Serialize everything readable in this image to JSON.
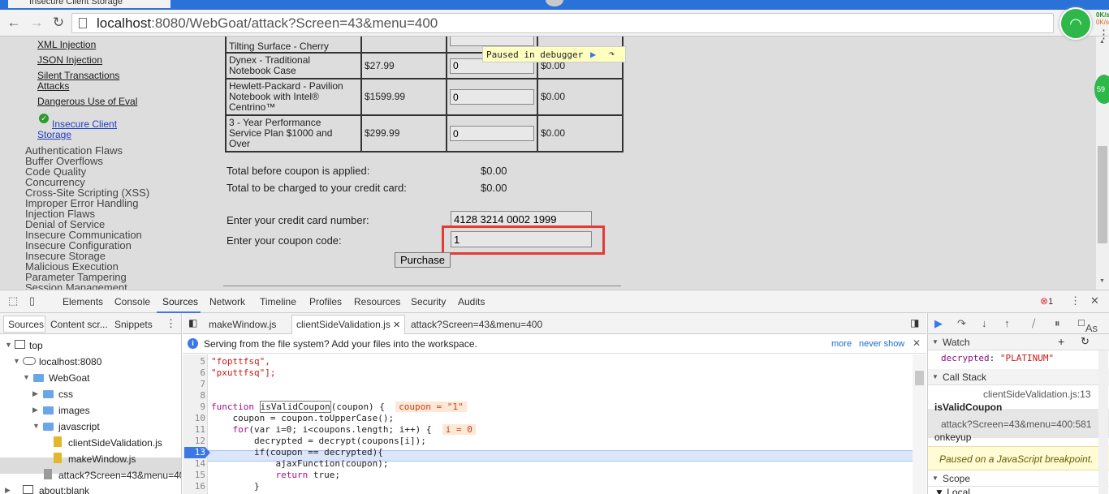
{
  "browser": {
    "tab_title": "Insecure Client Storage",
    "url_host": "localhost",
    "url_rest": ":8080/WebGoat/attack?Screen=43&menu=400",
    "extension_text": "59",
    "wifi_side_top": "0K/s",
    "wifi_side_bottom": "0K/s"
  },
  "sidebar": {
    "sub_links": [
      "XML Injection",
      "JSON Injection",
      "Silent Transactions",
      "Attacks",
      "Dangerous Use of Eval"
    ],
    "current_link_line1": "Insecure Client",
    "current_link_line2": "Storage",
    "categories": [
      "Authentication Flaws",
      "Buffer Overflows",
      "Code Quality",
      "Concurrency",
      "Cross-Site Scripting (XSS)",
      "Improper Error Handling",
      "Injection Flaws",
      "Denial of Service",
      "Insecure Communication",
      "Insecure Configuration",
      "Insecure Storage",
      "Malicious Execution",
      "Parameter Tampering",
      "Session Management"
    ]
  },
  "products": [
    {
      "line1": "Tilting Surface - Cherry",
      "line2": "",
      "line3": "",
      "price": "",
      "qty": "",
      "total": ""
    },
    {
      "line1": "Dynex - Traditional",
      "line2": "Notebook Case",
      "line3": "",
      "price": "$27.99",
      "qty": "0",
      "total": "$0.00"
    },
    {
      "line1": "Hewlett-Packard - Pavilion",
      "line2": "Notebook with Intel®",
      "line3": "Centrino™",
      "price": "$1599.99",
      "qty": "0",
      "total": "$0.00"
    },
    {
      "line1": "3 - Year Performance",
      "line2": "Service Plan $1000 and",
      "line3": "Over",
      "price": "$299.99",
      "qty": "0",
      "total": "$0.00"
    }
  ],
  "checkout": {
    "before_coupon_label": "Total before coupon is applied:",
    "before_coupon_value": "$0.00",
    "charged_label": "Total to be charged to your credit card:",
    "charged_value": "$0.00",
    "card_label": "Enter your credit card number:",
    "card_value": "4128 3214 0002 1999",
    "coupon_label": "Enter your coupon code:",
    "coupon_value": "1",
    "purchase_label": "Purchase"
  },
  "debugger_overlay": {
    "text": "Paused in debugger"
  },
  "devtools": {
    "tabs": [
      "Elements",
      "Console",
      "Sources",
      "Network",
      "Timeline",
      "Profiles",
      "Resources",
      "Security",
      "Audits"
    ],
    "error_count": "1",
    "navigator_tabs": [
      "Sources",
      "Content scr...",
      "Snippets"
    ],
    "tree": {
      "top": "top",
      "host": "localhost:8080",
      "webgoat": "WebGoat",
      "css": "css",
      "images": "images",
      "javascript": "javascript",
      "file1": "clientSideValidation.js",
      "file2": "makeWindow.js",
      "file3": "attack?Screen=43&menu=40",
      "blank": "about:blank"
    },
    "editor_tabs": [
      "makeWindow.js",
      "clientSideValidation.js",
      "attack?Screen=43&menu=400"
    ],
    "infobar": {
      "message": "Serving from the file system? Add your files into the workspace.",
      "more": "more",
      "never": "never show"
    },
    "line_numbers": [
      "5",
      "6",
      "7",
      "8",
      "9",
      "10",
      "11",
      "12",
      "13",
      "14",
      "15",
      "16"
    ],
    "code": {
      "l5": "\"fopttfsq\",",
      "l6": "\"pxuttfsq\"];",
      "l9_kw": "function",
      "l9_name": "isValidCoupon",
      "l9_rest": "(coupon) {",
      "l9_inline": "coupon = \"1\"",
      "l10": "    coupon = coupon.toUpperCase();",
      "l11_kw": "    for",
      "l11_rest": "(var i=0; i<coupons.length; i++) {",
      "l11_inline": "i = 0",
      "l12": "        decrypted = decrypt(coupons[i]);",
      "l13": "        if(coupon == decrypted){",
      "l14": "            ajaxFunction(coupon);",
      "l15_kw": "            return",
      "l15_rest": " true;",
      "l16": "        }"
    },
    "sidebar": {
      "watch_title": "Watch",
      "watch_name": "decrypted",
      "watch_value": "\"PLATINUM\"",
      "callstack_title": "Call Stack",
      "frame1_loc": "clientSideValidation.js:13",
      "frame1_name": "isValidCoupon",
      "frame2_loc": "attack?Screen=43&menu=400:581",
      "frame2_name": "onkeyup",
      "paused_msg": "Paused on a JavaScript breakpoint.",
      "scope_title": "Scope",
      "local_title": "Local",
      "async_label": "As"
    }
  }
}
